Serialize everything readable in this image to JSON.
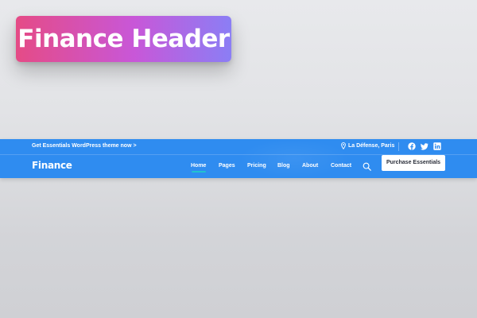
{
  "badge": {
    "title": "Finance Header",
    "colors": [
      "#e54b86",
      "#c857d8",
      "#8b7ef5"
    ]
  },
  "topbar": {
    "promo_text": "Get Essentials WordPress theme now >",
    "location": "La Défense, Paris",
    "location_icon": "map-pin-icon",
    "social_icons": [
      "facebook-icon",
      "twitter-icon",
      "linkedin-icon"
    ]
  },
  "navbar": {
    "brand": "Finance",
    "links": [
      "Home",
      "Pages",
      "Pricing",
      "Blog",
      "About",
      "Contact"
    ],
    "active_link": "Home",
    "search_icon": "search-icon",
    "cta_label": "Purchase Essentials"
  },
  "colors": {
    "header_bg": "#2f8cf0",
    "active_underline": "#22c2ce",
    "cta_bg": "#ffffff"
  }
}
